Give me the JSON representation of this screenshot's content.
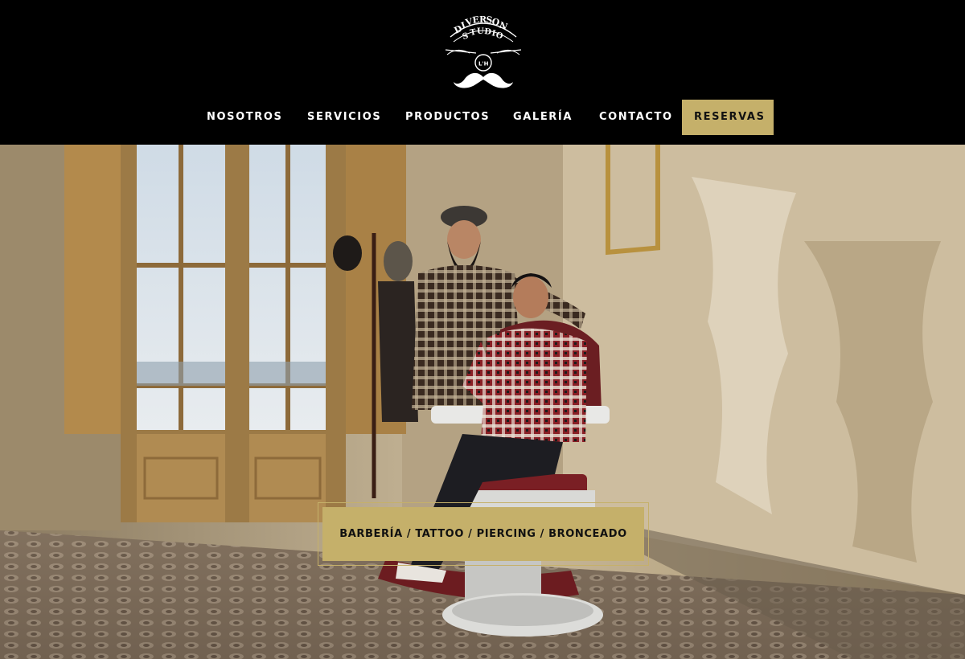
{
  "brand": {
    "logo_name": "Diverson Studio",
    "logo_icon": "mustache-logo-icon",
    "accent_color": "#c5b06a",
    "background_color": "#000000"
  },
  "nav": {
    "items": [
      {
        "label": "NOSOTROS"
      },
      {
        "label": "SERVICIOS"
      },
      {
        "label": "PRODUCTOS"
      },
      {
        "label": "GALERÍA"
      },
      {
        "label": "CONTACTO"
      }
    ],
    "cta_label": "RESERVAS"
  },
  "hero": {
    "image_subject": "barbershop-couple-photo",
    "services_label": "BARBERÍA / TATTOO / PIERCING / BRONCEADO"
  }
}
